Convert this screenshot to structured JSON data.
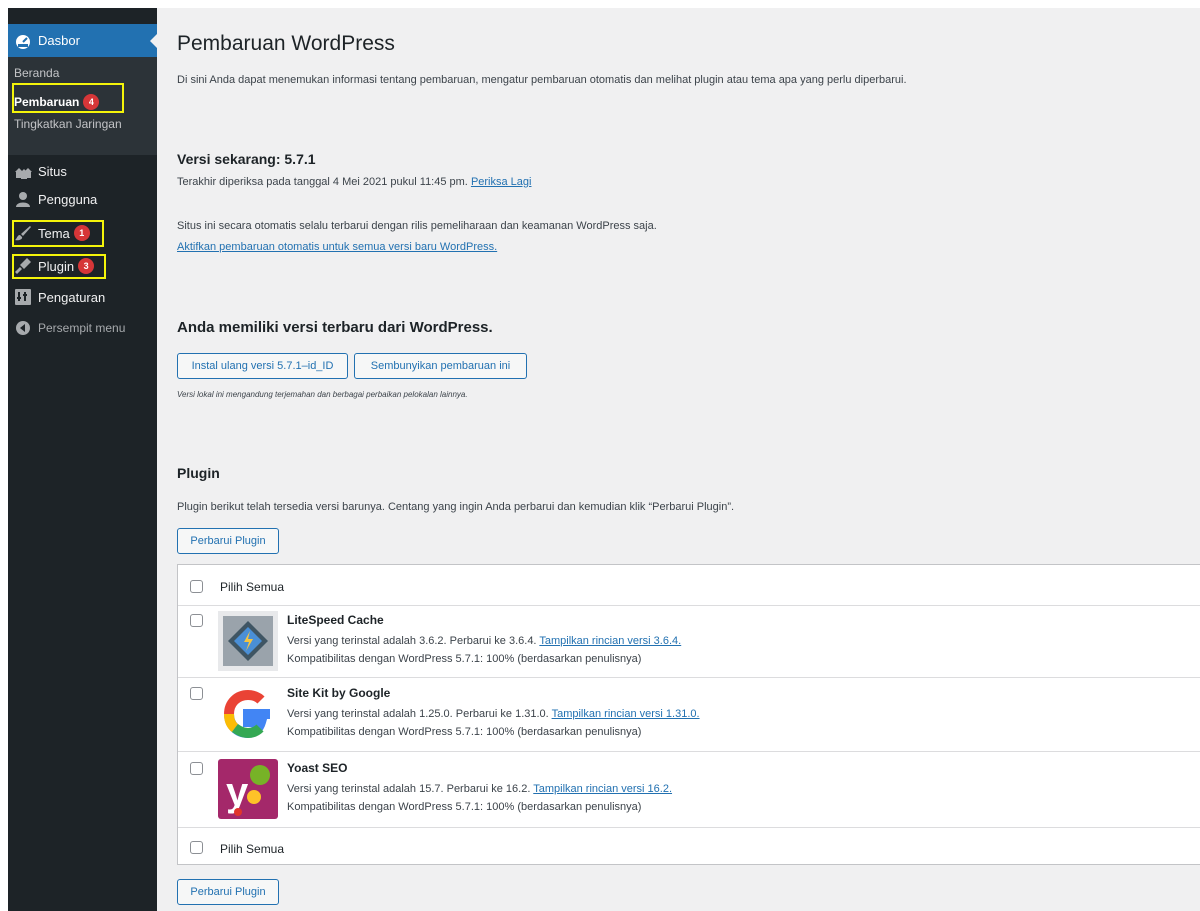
{
  "sidebar": {
    "dashboard_label": "Dasbor",
    "submenu": [
      {
        "label": "Beranda"
      },
      {
        "label": "Pembaruan",
        "badge": "4"
      },
      {
        "label": "Tingkatkan Jaringan"
      }
    ],
    "items": [
      {
        "label": "Situs",
        "icon": "sites-icon"
      },
      {
        "label": "Pengguna",
        "icon": "users-icon"
      },
      {
        "label": "Tema",
        "icon": "brush-icon",
        "badge": "1"
      },
      {
        "label": "Plugin",
        "icon": "plugin-icon",
        "badge": "3"
      },
      {
        "label": "Pengaturan",
        "icon": "settings-icon"
      }
    ],
    "collapse_label": "Persempit menu"
  },
  "page": {
    "title": "Pembaruan WordPress",
    "intro": "Di sini Anda dapat menemukan informasi tentang pembaruan, mengatur pembaruan otomatis dan melihat plugin atau tema apa yang perlu diperbarui."
  },
  "version": {
    "heading": "Versi sekarang: 5.7.1",
    "last_checked": "Terakhir diperiksa pada tanggal 4 Mei 2021 pukul 11:45 pm.",
    "check_again": "Periksa Lagi",
    "auto_text": "Situs ini secara otomatis selalu terbarui dengan rilis pemeliharaan dan keamanan WordPress saja.",
    "auto_link": "Aktifkan pembaruan otomatis untuk semua versi baru WordPress."
  },
  "latest": {
    "heading": "Anda memiliki versi terbaru dari WordPress.",
    "reinstall_button": "Instal ulang versi 5.7.1–id_ID",
    "hide_button": "Sembunyikan pembaruan ini",
    "note": "Versi lokal ini mengandung terjemahan dan berbagai perbaikan pelokalan lainnya."
  },
  "plugins": {
    "heading": "Plugin",
    "description": "Plugin berikut telah tersedia versi barunya. Centang yang ingin Anda perbarui dan kemudian klik “Perbarui Plugin”.",
    "update_button": "Perbarui Plugin",
    "select_all": "Pilih Semua",
    "list": [
      {
        "name": "LiteSpeed Cache",
        "installed": "Versi yang terinstal adalah 3.6.2. Perbarui ke 3.6.4.",
        "details_link": "Tampilkan rincian versi 3.6.4.",
        "compat": "Kompatibilitas dengan WordPress 5.7.1: 100% (berdasarkan penulisnya)",
        "icon": "litespeed-icon"
      },
      {
        "name": "Site Kit by Google",
        "installed": "Versi yang terinstal adalah 1.25.0. Perbarui ke 1.31.0.",
        "details_link": "Tampilkan rincian versi 1.31.0.",
        "compat": "Kompatibilitas dengan WordPress 5.7.1: 100% (berdasarkan penulisnya)",
        "icon": "google-icon"
      },
      {
        "name": "Yoast SEO",
        "installed": "Versi yang terinstal adalah 15.7. Perbarui ke 16.2.",
        "details_link": "Tampilkan rincian versi 16.2.",
        "compat": "Kompatibilitas dengan WordPress 5.7.1: 100% (berdasarkan penulisnya)",
        "icon": "yoast-icon"
      }
    ]
  },
  "colors": {
    "sidebar_bg": "#1d2327",
    "accent": "#2271b1",
    "badge": "#d63638",
    "highlight_box": "#f4f40a"
  }
}
